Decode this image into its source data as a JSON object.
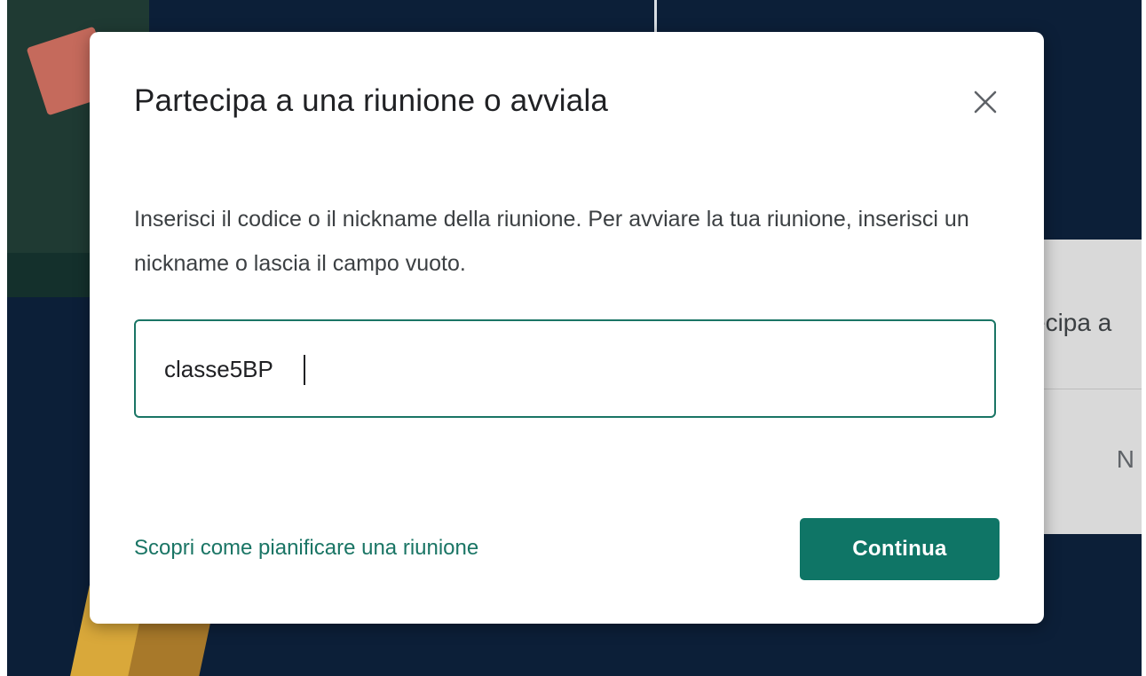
{
  "dialog": {
    "title": "Partecipa a una riunione o avviala",
    "close_icon": "close-icon",
    "description": "Inserisci il codice o il nickname della riunione. Per avviare la tua riunione, inserisci un nickname o lascia il campo vuoto.",
    "input_value": "classe5BP",
    "learn_link": "Scopri come pianificare una riunione",
    "continue_label": "Continua"
  },
  "background": {
    "side_card_text": "ecipa a",
    "side_card_letter": "N"
  },
  "colors": {
    "accent": "#0f7566",
    "link": "#1a7565",
    "title_text": "#202124",
    "body_text": "#3c4043",
    "backdrop": "#0c1f38"
  }
}
